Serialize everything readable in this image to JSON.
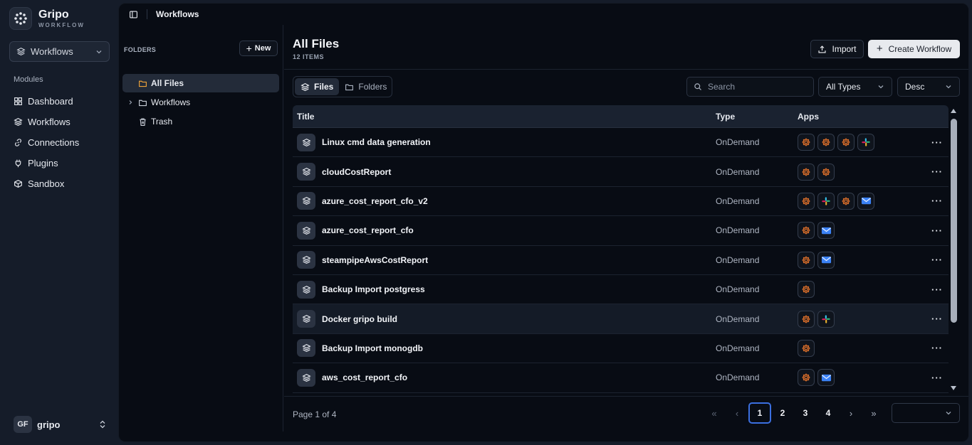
{
  "brand": {
    "name": "Gripo",
    "sub": "WORKFLOW"
  },
  "module_select": {
    "value": "Workflows"
  },
  "modules_title": "Modules",
  "nav": [
    {
      "label": "Dashboard",
      "icon": "dashboard-icon"
    },
    {
      "label": "Workflows",
      "icon": "layers-icon"
    },
    {
      "label": "Connections",
      "icon": "link-icon"
    },
    {
      "label": "Plugins",
      "icon": "plug-icon"
    },
    {
      "label": "Sandbox",
      "icon": "box-icon"
    }
  ],
  "user": {
    "initials": "GF",
    "name": "gripo"
  },
  "breadcrumb": "Workflows",
  "folders": {
    "title": "FOLDERS",
    "new_label": "New",
    "items": [
      {
        "label": "All Files",
        "active": true
      },
      {
        "label": "Workflows",
        "active": false
      },
      {
        "label": "Trash",
        "active": false
      }
    ]
  },
  "content": {
    "title": "All Files",
    "count": "12 ITEMS",
    "import_label": "Import",
    "create_label": "Create Workflow",
    "tabs": [
      {
        "label": "Files",
        "active": true
      },
      {
        "label": "Folders",
        "active": false
      }
    ],
    "search_placeholder": "Search",
    "type_filter": "All Types",
    "sort": "Desc"
  },
  "table": {
    "columns": [
      "Title",
      "Type",
      "Apps"
    ],
    "rows": [
      {
        "title": "Linux cmd data generation",
        "type": "OnDemand",
        "apps": [
          "gear",
          "gear",
          "gear",
          "slack"
        ]
      },
      {
        "title": "cloudCostReport",
        "type": "OnDemand",
        "apps": [
          "gear",
          "gear"
        ]
      },
      {
        "title": "azure_cost_report_cfo_v2",
        "type": "OnDemand",
        "apps": [
          "gear",
          "slack",
          "gear",
          "mail"
        ]
      },
      {
        "title": "azure_cost_report_cfo",
        "type": "OnDemand",
        "apps": [
          "gear",
          "mail"
        ]
      },
      {
        "title": "steampipeAwsCostReport",
        "type": "OnDemand",
        "apps": [
          "gear",
          "mail"
        ]
      },
      {
        "title": "Backup Import postgress",
        "type": "OnDemand",
        "apps": [
          "gear"
        ]
      },
      {
        "title": "Docker gripo build",
        "type": "OnDemand",
        "apps": [
          "gear",
          "slack"
        ]
      },
      {
        "title": "Backup Import monogdb",
        "type": "OnDemand",
        "apps": [
          "gear"
        ]
      },
      {
        "title": "aws_cost_report_cfo",
        "type": "OnDemand",
        "apps": [
          "gear",
          "mail"
        ]
      },
      {
        "title": "",
        "type": "",
        "apps": []
      }
    ]
  },
  "pagination": {
    "info": "Page 1 of 4",
    "pages": [
      "1",
      "2",
      "3",
      "4"
    ],
    "current": "1"
  },
  "colors": {
    "accent": "#3b6fe0",
    "gear": "#e8742b",
    "mail": "#3b82f6"
  }
}
